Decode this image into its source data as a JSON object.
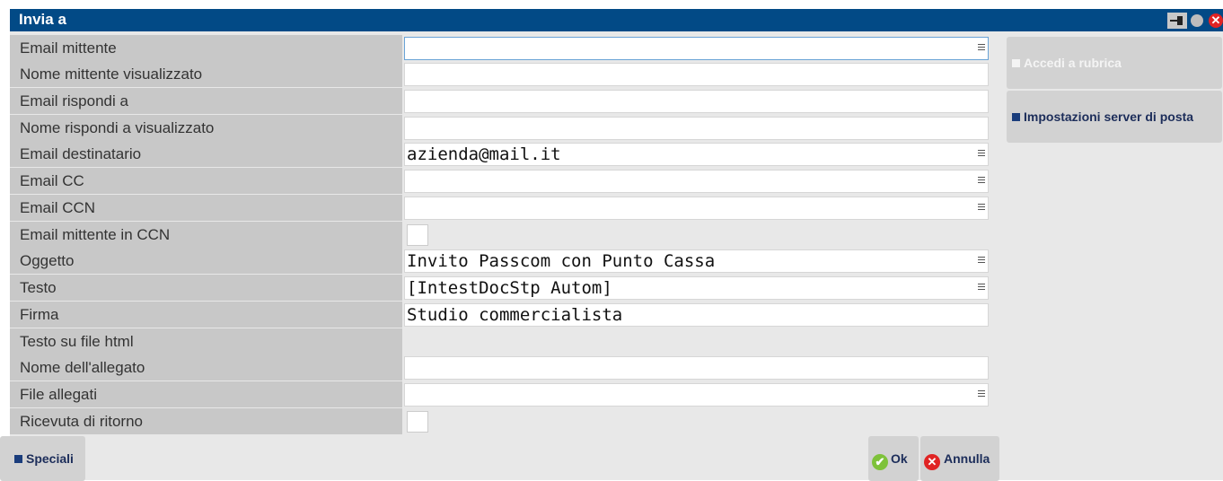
{
  "window": {
    "title": "Invia a"
  },
  "form": {
    "rows": [
      {
        "label": "Email mittente",
        "value": ""
      },
      {
        "label": "Nome mittente visualizzato",
        "value": ""
      },
      {
        "label": "Email rispondi a",
        "value": ""
      },
      {
        "label": "Nome rispondi a visualizzato",
        "value": ""
      },
      {
        "label": "Email destinatario",
        "value": "azienda@mail.it"
      },
      {
        "label": "Email CC",
        "value": ""
      },
      {
        "label": "Email CCN",
        "value": ""
      },
      {
        "label": "Email mittente in CCN",
        "checked": false
      },
      {
        "label": "Oggetto",
        "value": "Invito Passcom con Punto Cassa"
      },
      {
        "label": "Testo",
        "value": "[IntestDocStp Autom]"
      },
      {
        "label": "Firma",
        "value": "Studio commercialista"
      },
      {
        "label": "Testo su file html"
      },
      {
        "label": "Nome dell'allegato",
        "value": ""
      },
      {
        "label": "File allegati",
        "value": ""
      },
      {
        "label": "Ricevuta di ritorno",
        "checked": false
      }
    ]
  },
  "side_buttons": {
    "rubrica": "Accedi a rubrica",
    "server": "Impostazioni server di posta"
  },
  "bottom_buttons": {
    "speciali": "Speciali",
    "ok": "Ok",
    "annulla": "Annulla"
  },
  "icons": {
    "pin": "pin-icon",
    "circle": "circle-icon",
    "close": "close-icon",
    "menu": "menu-icon",
    "ok": "check-icon",
    "annulla": "x-icon"
  },
  "colors": {
    "titlebar": "#024a86",
    "label_bg": "#c8c8c8",
    "button_bg": "#d2d2d2",
    "ok_green": "#7ec23a",
    "cancel_red": "#e02424"
  }
}
